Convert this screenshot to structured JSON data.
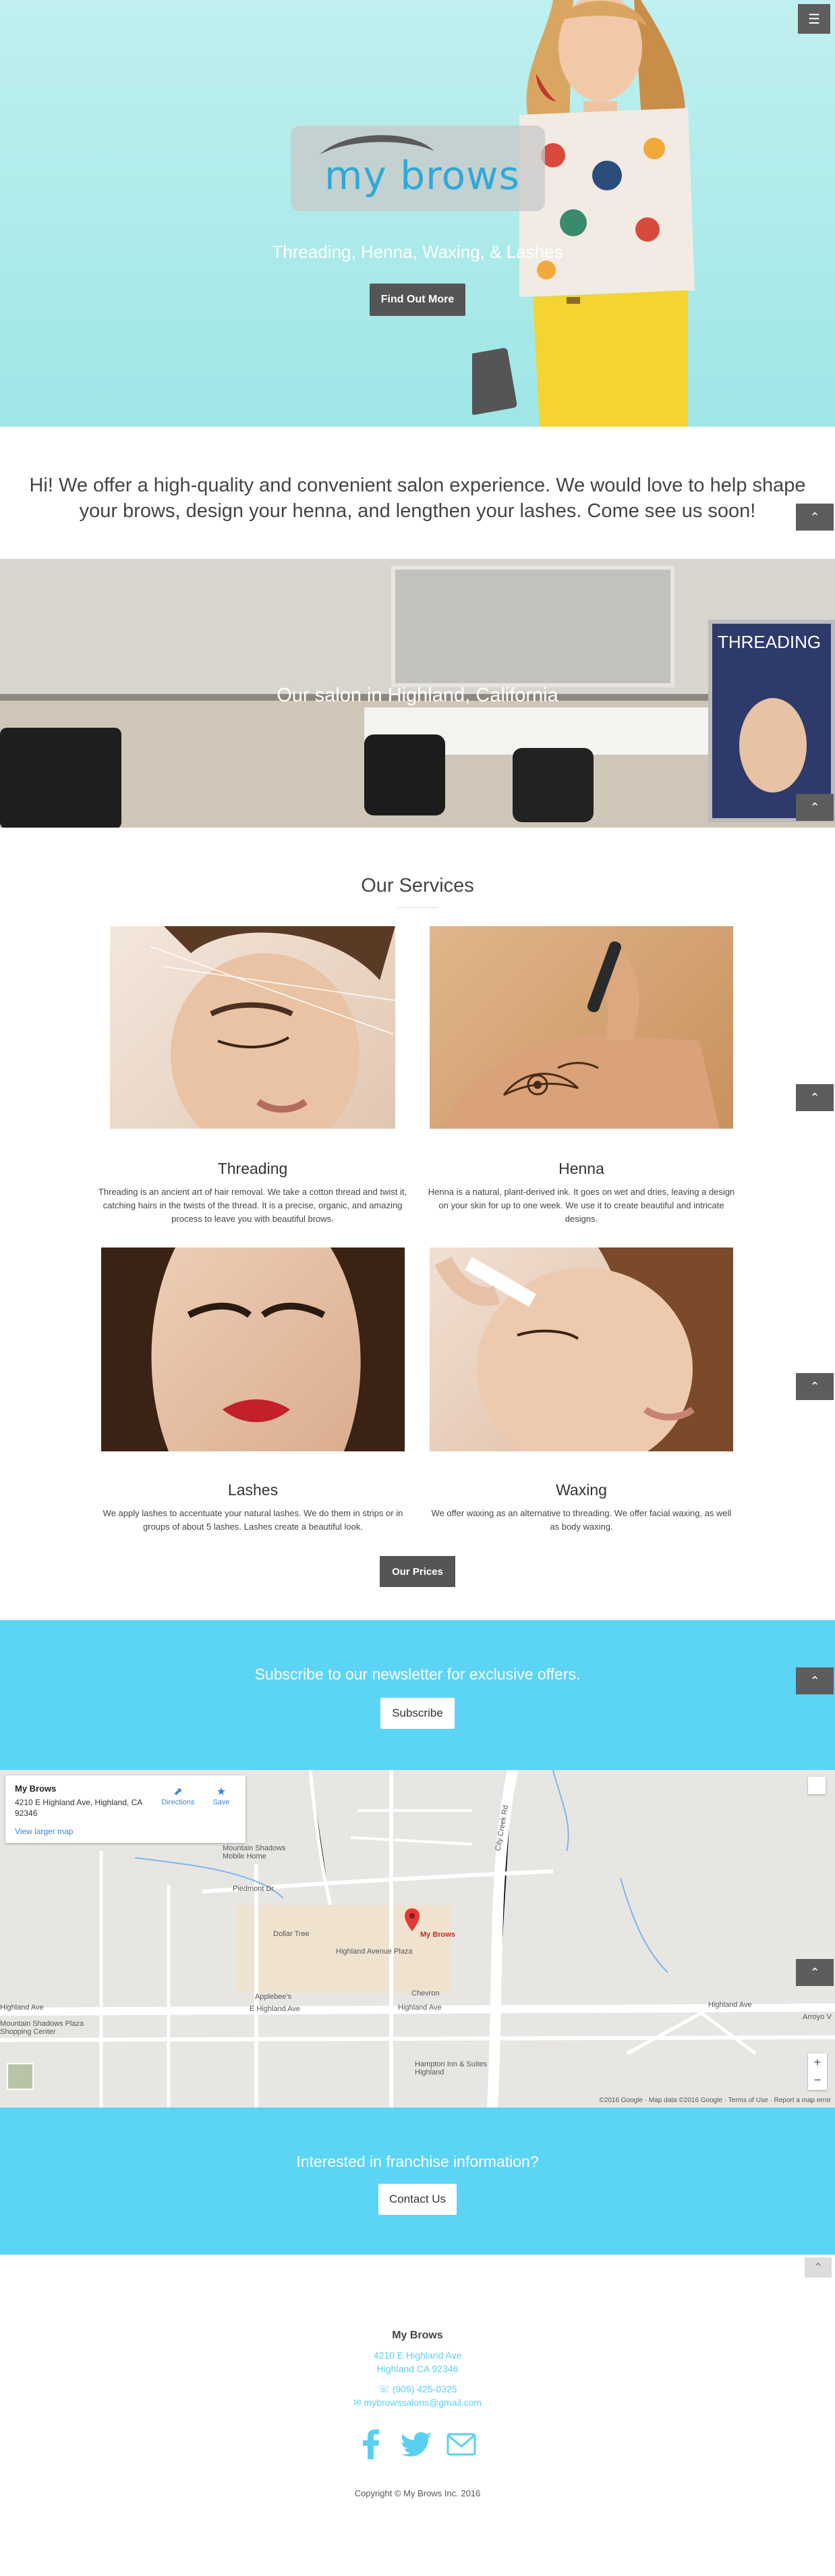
{
  "hero": {
    "logo_text": "my brows",
    "tagline": "Threading, Henna, Waxing, & Lashes",
    "cta_label": "Find Out More",
    "menu_icon": "hamburger-icon",
    "accent": "#9fe6e6"
  },
  "intro": {
    "text": "Hi! We offer a high-quality and convenient salon experience. We would love to help shape your brows, design your henna, and lengthen your lashes. Come see us soon!"
  },
  "salon": {
    "caption": "Our salon in Highland, California",
    "poster_text": "THREADING"
  },
  "services": {
    "title": "Our Services",
    "items": [
      {
        "name": "Threading",
        "desc": "Threading is an ancient art of hair removal. We take a cotton thread and twist it, catching hairs in the twists of the thread. It is a precise, organic, and amazing process to leave you with beautiful brows."
      },
      {
        "name": "Henna",
        "desc": "Henna is a natural, plant-derived ink. It goes on wet and dries, leaving a design on your skin for up to one week. We use it to create beautiful and intricate designs."
      },
      {
        "name": "Lashes",
        "desc": "We apply lashes to accentuate your natural lashes. We do them in strips or in groups of about 5 lashes. Lashes create a beautiful look."
      },
      {
        "name": "Waxing",
        "desc": "We offer waxing as an alternative to threading. We offer facial waxing, as well as body waxing."
      }
    ],
    "prices_label": "Our Prices"
  },
  "newsletter": {
    "title": "Subscribe to our newsletter for exclusive offers.",
    "button_label": "Subscribe",
    "color": "#5cd4f5"
  },
  "map": {
    "card_title": "My Brows",
    "card_address": "4210 E Highland Ave, Highland, CA 92346",
    "directions_label": "Directions",
    "save_label": "Save",
    "view_larger": "View larger map",
    "pin_label": "My Brows",
    "labels": {
      "mountain_shadows_mobile": "Mountain Shadows Mobile Home",
      "dollar_tree": "Dollar Tree",
      "highland_plaza": "Highland Avenue Plaza",
      "chevron": "Chevron",
      "applebees": "Applebee's",
      "e_highland_ave": "E Highland Ave",
      "highland_ave": "Highland Ave",
      "highland_ave_left": "Highland Ave",
      "highland_ave_right": "Highland Ave",
      "mountain_shadows_plaza": "Mountain Shadows Plaza Shopping Center",
      "hampton_inn": "Hampton Inn & Suites Highland",
      "city_creek_rd": "City Creek Rd",
      "piedmont_dr": "Piedmont Dr",
      "arroyo_v": "Arroyo V"
    },
    "footer": "©2016 Google · Map data ©2016 Google · Terms of Use · Report a map error"
  },
  "franchise": {
    "title": "Interested in franchise information?",
    "button_label": "Contact Us"
  },
  "footer": {
    "name": "My Brows",
    "address1": "4210 E Highland Ave",
    "address2": "Highland CA 92346",
    "phone": "☏ (909) 425-0325",
    "email": "✉ mybrowssalons@gmail.com",
    "copyright": "Copyright © My Brows Inc. 2016",
    "social_icons": [
      "facebook-icon",
      "twitter-icon",
      "envelope-icon"
    ]
  }
}
